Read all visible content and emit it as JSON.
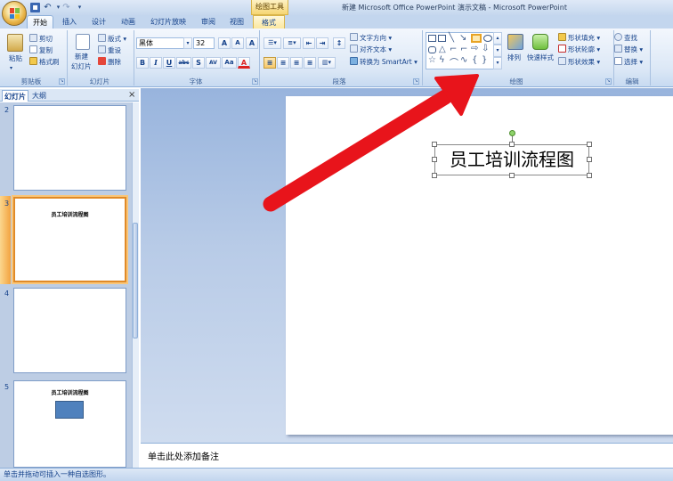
{
  "window_title": "新建 Microsoft Office PowerPoint 演示文稿 - Microsoft PowerPoint",
  "contextual_tab_group": "绘图工具",
  "quick_access": {
    "save_icon": "save-icon",
    "undo_icon": "undo-icon",
    "redo_icon": "redo-icon"
  },
  "tabs": [
    "开始",
    "插入",
    "设计",
    "动画",
    "幻灯片放映",
    "审阅",
    "视图",
    "格式"
  ],
  "ribbon": {
    "clipboard": {
      "paste": "粘贴",
      "cut": "剪切",
      "copy": "复制",
      "format_painter": "格式刷",
      "label": "剪贴板"
    },
    "slides": {
      "new_slide_1": "新建",
      "new_slide_2": "幻灯片",
      "layout": "版式",
      "reset": "重设",
      "delete": "删除",
      "label": "幻灯片"
    },
    "font": {
      "font_name": "黑体",
      "font_size": "32",
      "grow": "A",
      "shrink": "A",
      "clear": "A",
      "bold": "B",
      "italic": "I",
      "underline": "U",
      "strike": "abc",
      "shadow": "S",
      "spacing": "AV",
      "case": "Aa",
      "color": "A",
      "label": "字体"
    },
    "paragraph": {
      "text_direction": "文字方向",
      "align_text": "对齐文本",
      "smartart": "转换为 SmartArt",
      "label": "段落"
    },
    "drawing": {
      "arrange": "排列",
      "quick_styles": "快速样式",
      "shape_fill": "形状填充",
      "shape_outline": "形状轮廓",
      "shape_effects": "形状效果",
      "label": "绘图"
    },
    "editing": {
      "find": "查找",
      "replace": "替换",
      "select": "选择",
      "label": "编辑"
    }
  },
  "pane": {
    "tab_slides": "幻灯片",
    "tab_outline": "大纲",
    "close": "×"
  },
  "slides": [
    {
      "number": "2",
      "title": ""
    },
    {
      "number": "3",
      "title": "员工培训流程图"
    },
    {
      "number": "4",
      "title": ""
    },
    {
      "number": "5",
      "title": "员工培训流程图"
    }
  ],
  "slide_title": "员工培训流程图",
  "notes_placeholder": "单击此处添加备注",
  "status_text": "单击并拖动可插入一种自选图形。",
  "colors": {
    "arrow": "#e8141b",
    "accent": "#15428b",
    "selected_thumb": "#e08a28"
  }
}
